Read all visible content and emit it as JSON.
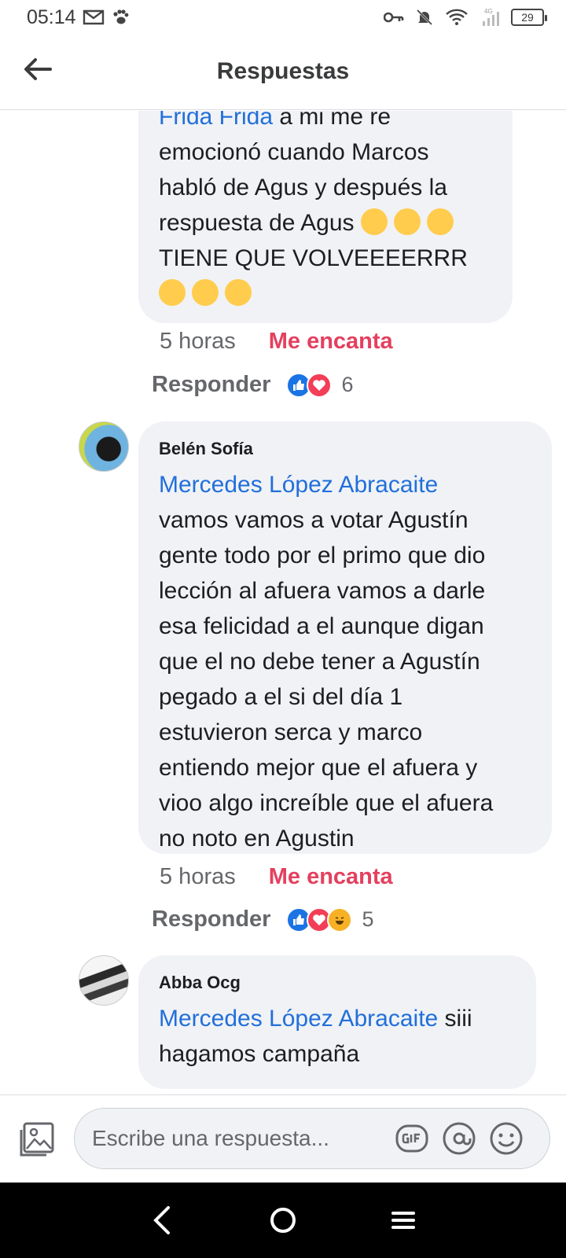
{
  "status_bar": {
    "time": "05:14",
    "battery": "29",
    "network": "4G"
  },
  "header": {
    "title": "Respuestas"
  },
  "comments": [
    {
      "author": "",
      "mention": "Frida Frida",
      "text": " a mi me re\nemocionó cuando Marcos\nhabló de Agus y después la\nrespuesta de Agus",
      "text_line2": "TIENE QUE VOLVEEEERRR",
      "time": "5 horas",
      "reaction_label": "Me encanta",
      "reply_label": "Responder",
      "reaction_count": "6",
      "reaction_icons": [
        "like-icon",
        "love-icon"
      ]
    },
    {
      "author": "Belén Sofía",
      "mention": "Mercedes López Abracaite",
      "text": "vamos vamos a votar Agustín\ngente todo por el primo que dio\nlección al afuera vamos a darle\nesa felicidad a el aunque digan\nque el no debe tener a Agustín\npegado a el si del día 1\nestuvieron serca y marco\nentiendo mejor que el afuera y\nvioo algo increíble que el afuera\nno noto en Agustin",
      "time": "5 horas",
      "reaction_label": "Me encanta",
      "reply_label": "Responder",
      "reaction_count": "5",
      "reaction_icons": [
        "like-icon",
        "love-icon",
        "haha-icon"
      ]
    },
    {
      "author": "Abba Ocg",
      "mention": "Mercedes López Abracaite",
      "text": " siii\nhagamos campaña"
    }
  ],
  "composer": {
    "placeholder": "Escribe una respuesta..."
  },
  "colors": {
    "mention": "#216fdb",
    "love": "#e4405f",
    "bubble": "#f0f2f5"
  }
}
